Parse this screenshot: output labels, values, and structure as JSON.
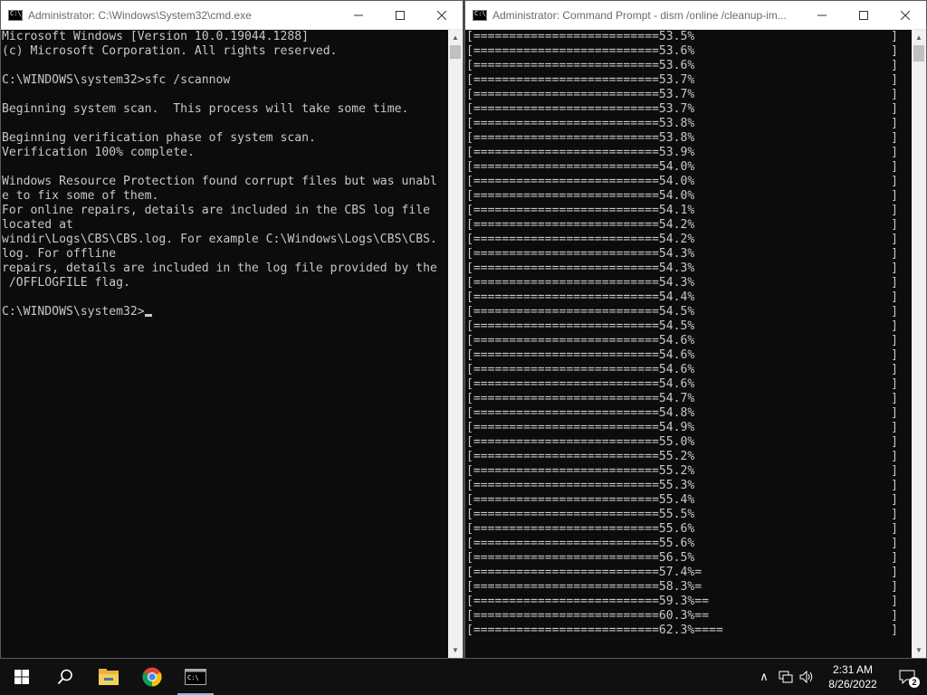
{
  "left_window": {
    "title": "Administrator: C:\\Windows\\System32\\cmd.exe",
    "lines": [
      "Microsoft Windows [Version 10.0.19044.1288]",
      "(c) Microsoft Corporation. All rights reserved.",
      "",
      "C:\\WINDOWS\\system32>sfc /scannow",
      "",
      "Beginning system scan.  This process will take some time.",
      "",
      "Beginning verification phase of system scan.",
      "Verification 100% complete.",
      "",
      "Windows Resource Protection found corrupt files but was unabl",
      "e to fix some of them.",
      "For online repairs, details are included in the CBS log file",
      "located at",
      "windir\\Logs\\CBS\\CBS.log. For example C:\\Windows\\Logs\\CBS\\CBS.",
      "log. For offline",
      "repairs, details are included in the log file provided by the",
      " /OFFLOGFILE flag.",
      ""
    ],
    "prompt": "C:\\WINDOWS\\system32>"
  },
  "right_window": {
    "title": "Administrator: Command Prompt - dism  /online /cleanup-im...",
    "bar_prefix": "[==========================",
    "bar_suffix": "]",
    "progress_lines": [
      "53.5%",
      "53.6%",
      "53.6%",
      "53.7%",
      "53.7%",
      "53.7%",
      "53.8%",
      "53.8%",
      "53.9%",
      "54.0%",
      "54.0%",
      "54.0%",
      "54.1%",
      "54.2%",
      "54.2%",
      "54.3%",
      "54.3%",
      "54.3%",
      "54.4%",
      "54.5%",
      "54.5%",
      "54.6%",
      "54.6%",
      "54.6%",
      "54.6%",
      "54.7%",
      "54.8%",
      "54.9%",
      "55.0%",
      "55.2%",
      "55.2%",
      "55.3%",
      "55.4%",
      "55.5%",
      "55.6%",
      "55.6%",
      "56.5%",
      "57.4%=",
      "58.3%=",
      "59.3%==",
      "60.3%==",
      "62.3%===="
    ]
  },
  "controls": {
    "minimize": "—",
    "maximize": "☐",
    "close": "✕"
  },
  "taskbar": {
    "icons": [
      "windows-start-icon",
      "search-icon",
      "file-explorer-icon",
      "chrome-icon",
      "command-prompt-icon"
    ],
    "tray": {
      "chevron": "∧",
      "network": "network-icon",
      "volume": "volume-icon"
    },
    "time": "2:31 AM",
    "date": "8/26/2022",
    "notification_count": "2"
  },
  "colors": {
    "console_bg": "#0c0c0c",
    "console_text": "#c8c8c8",
    "taskbar_bg": "#101010",
    "titlebar_bg": "#ffffff"
  }
}
